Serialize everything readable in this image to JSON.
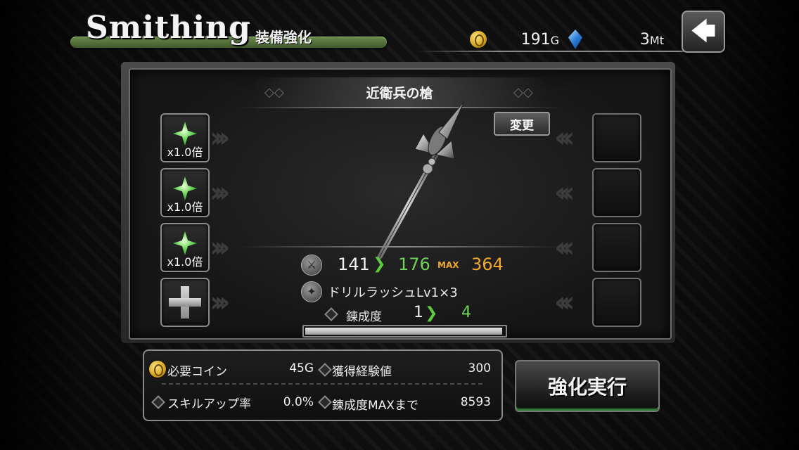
{
  "header": {
    "title": "Smithing",
    "subtitle": "装備強化",
    "gold_amount": "191",
    "gold_unit": "G",
    "mt_amount": "3",
    "mt_unit": "Mt",
    "back_label": "🡄"
  },
  "weapon": {
    "name": "近衛兵の槍",
    "change_label": "変更"
  },
  "materials": [
    {
      "multiplier": "x1.0倍"
    },
    {
      "multiplier": "x1.0倍"
    },
    {
      "multiplier": "x1.0倍"
    }
  ],
  "stats": {
    "attack_current": "141",
    "attack_new": "176",
    "max_label": "MAX",
    "attack_max": "364",
    "skill": "ドリルラッシュLv1×3",
    "refine_label": "錬成度",
    "refine_current": "1",
    "refine_new": "4",
    "refine_progress": 0.99
  },
  "info": {
    "coin_label": "必要コイン",
    "coin_value": "45G",
    "exp_label": "獲得経験値",
    "exp_value": "300",
    "skillup_label": "スキルアップ率",
    "skillup_value": "0.0%",
    "refine_max_label": "錬成度MAXまで",
    "refine_max_value": "8593"
  },
  "execute_label": "強化実行",
  "colors": {
    "accent_green": "#6fd15a",
    "max_orange": "#f0a830",
    "title_bar_green": "#4f6e38"
  }
}
